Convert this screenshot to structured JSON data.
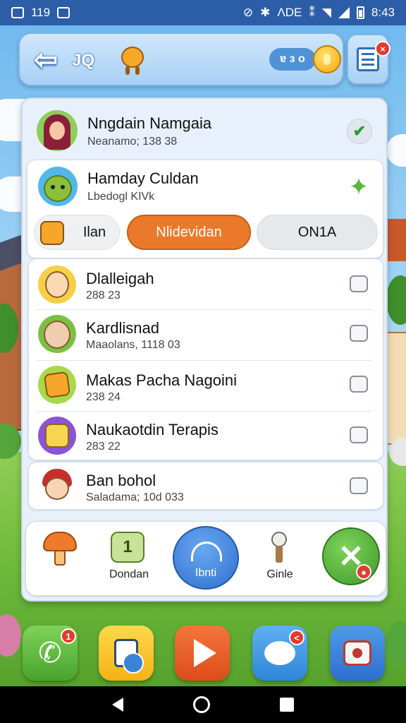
{
  "status_bar": {
    "time_left": "119",
    "network_text": "ΛDΕ",
    "clock": "8:43"
  },
  "header": {
    "title": "JQ",
    "coin_value": "ɐ ɜ o",
    "menu_badge": "×"
  },
  "contacts": [
    {
      "name": "Nngdain Namgaia",
      "sub": "Neanamo; 138 38",
      "action": "check-icon"
    },
    {
      "name": "Hamday Culdan",
      "sub": "Lbedogl KIVk",
      "action": "star-icon"
    }
  ],
  "tabs": [
    {
      "label": "Ilan",
      "active": false
    },
    {
      "label": "Nlidevidan",
      "active": true
    },
    {
      "label": "ON1A",
      "active": false
    }
  ],
  "list": [
    {
      "name": "Dlalleigah",
      "sub": "288 23",
      "checked": false
    },
    {
      "name": "Kardlisnad",
      "sub": "Maaolans, 1118 03",
      "checked": false
    },
    {
      "name": "Makas Pacha Nagoini",
      "sub": "238 24",
      "checked": false
    },
    {
      "name": "Naukaotdin Terapis",
      "sub": "283 22",
      "checked": false
    },
    {
      "name": "Ban bohol",
      "sub": "Saladama; 10d 033",
      "checked": false
    }
  ],
  "bottom_actions": [
    {
      "label": ""
    },
    {
      "label": "Dondan"
    },
    {
      "label": "Ibnti"
    },
    {
      "label": "Ginle"
    },
    {
      "label": ""
    }
  ],
  "dock": [
    {
      "icon": "phone-icon",
      "badge": "1",
      "color": "#5fbd3e"
    },
    {
      "icon": "gallery-icon",
      "badge": "",
      "color": "#f6c42a"
    },
    {
      "icon": "play-icon",
      "badge": "",
      "color": "#ec5b26"
    },
    {
      "icon": "chat-icon",
      "badge": "<",
      "color": "#3a93de"
    },
    {
      "icon": "camera-icon",
      "badge": "",
      "color": "#3479cf"
    }
  ],
  "colors": {
    "accent_orange": "#ea7a2a",
    "header_blue": "#2c5ea7",
    "check_green": "#4aa832"
  }
}
